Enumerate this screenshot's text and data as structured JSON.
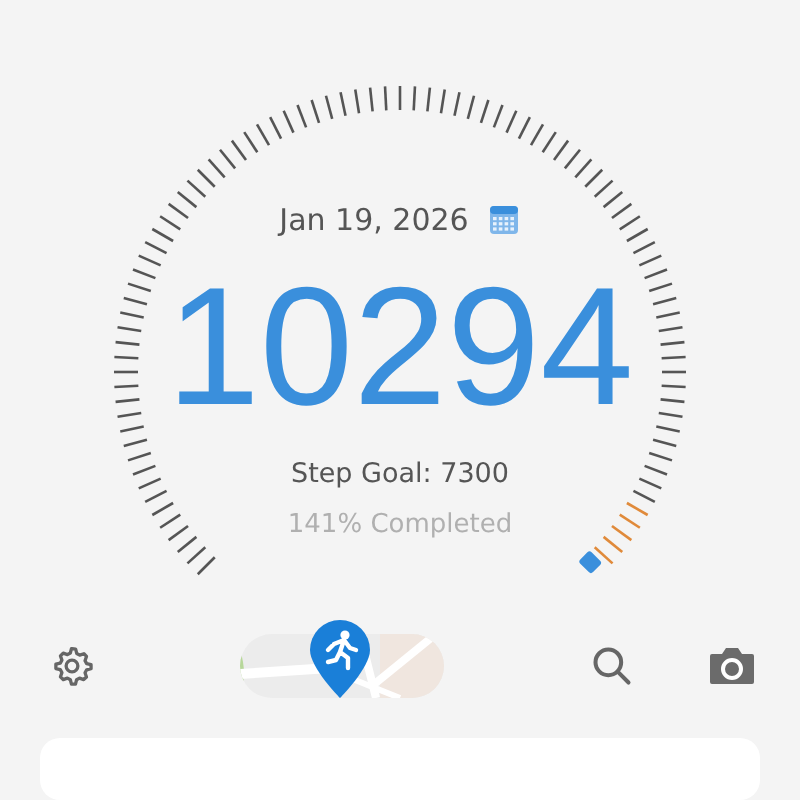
{
  "date": "Jan 19, 2026",
  "steps": "10294",
  "step_goal": "Step Goal: 7300",
  "completed": "141% Completed"
}
